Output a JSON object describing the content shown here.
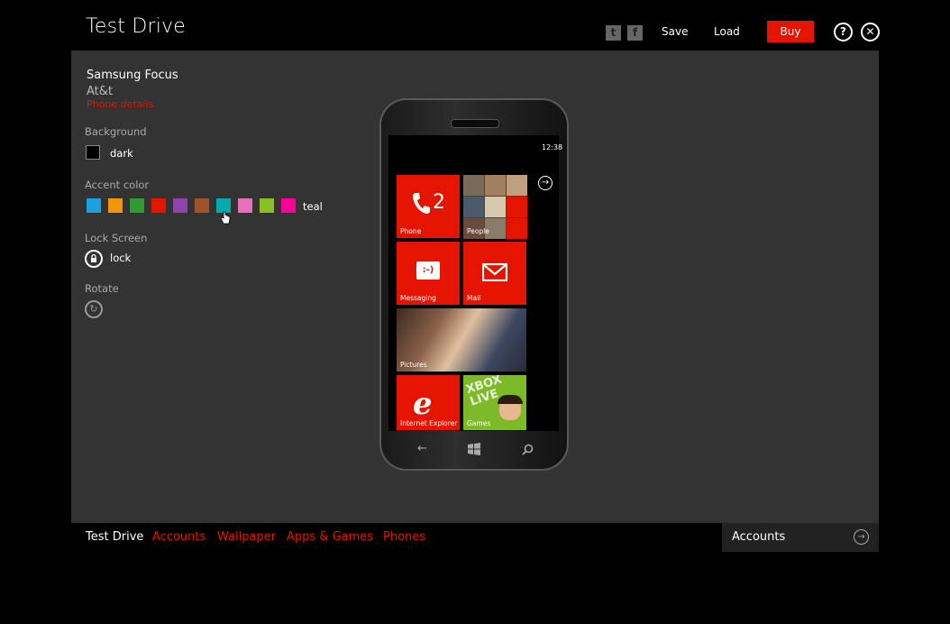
{
  "header": {
    "title": "Test Drive",
    "twitter_icon": "twitter-icon",
    "facebook_icon": "facebook-icon",
    "save_label": "Save",
    "load_label": "Load",
    "buy_label": "Buy",
    "help_icon": "help-icon",
    "close_icon": "close-icon",
    "buy_color": "#e51400"
  },
  "device": {
    "name": "Samsung Focus",
    "carrier": "At&t",
    "details_link": "Phone details"
  },
  "settings": {
    "background": {
      "label": "Background",
      "value": "dark",
      "color": "#000000"
    },
    "accent": {
      "label": "Accent color",
      "value": "teal",
      "colors": [
        "#1ba1e2",
        "#f09609",
        "#339933",
        "#e51400",
        "#8e44ad",
        "#a0522d",
        "#00aba9",
        "#e671b8",
        "#8cbf26",
        "#ff0097"
      ],
      "selected_index": 6
    },
    "lock_screen": {
      "label": "Lock Screen",
      "value": "lock"
    },
    "rotate": {
      "label": "Rotate"
    }
  },
  "phone_screen": {
    "clock": "12:38",
    "tiles": {
      "phone": {
        "label": "Phone",
        "count": "2"
      },
      "people": {
        "label": "People"
      },
      "messaging": {
        "label": "Messaging",
        "glyph": ":-)"
      },
      "mail": {
        "label": "Mail"
      },
      "pictures": {
        "label": "Pictures"
      },
      "ie": {
        "label": "Internet Explorer"
      },
      "xbox": {
        "label": "Games",
        "brand": "XBOX LIVE"
      }
    }
  },
  "bottom_nav": {
    "items": [
      {
        "label": "Test Drive",
        "active": true
      },
      {
        "label": "Accounts",
        "active": false
      },
      {
        "label": "Wallpaper",
        "active": false
      },
      {
        "label": "Apps & Games",
        "active": false
      },
      {
        "label": "Phones",
        "active": false
      }
    ],
    "active_color": "#ffffff",
    "link_color": "#e51400"
  },
  "next_panel": {
    "label": "Accounts",
    "icon": "arrow-right-circle-icon"
  }
}
